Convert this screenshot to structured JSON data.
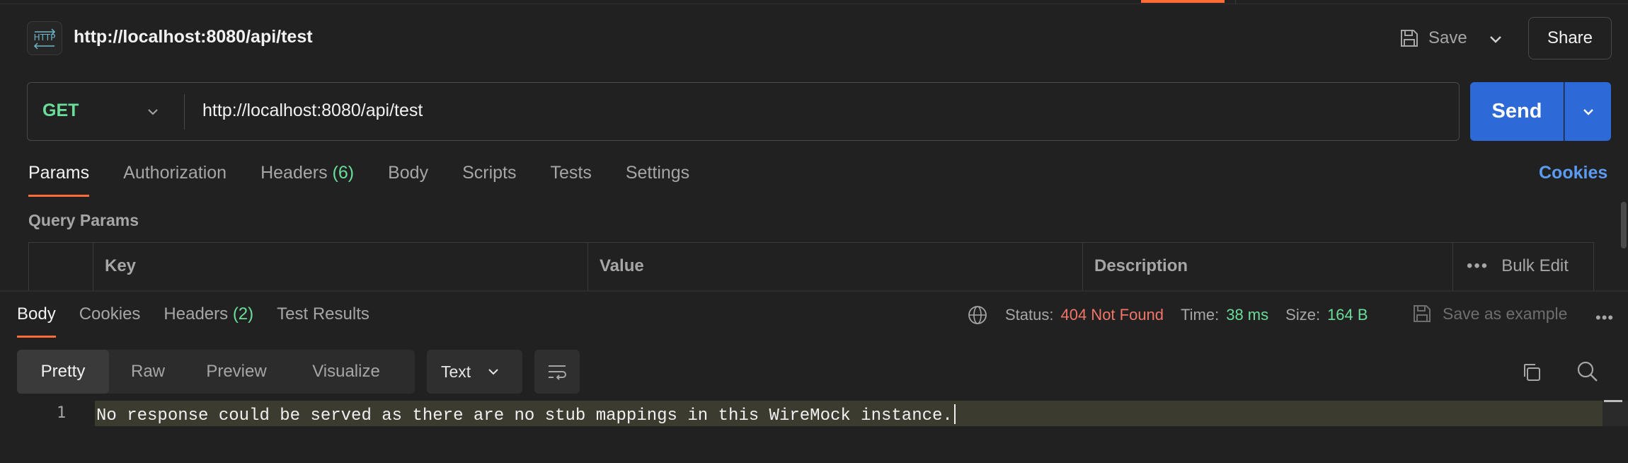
{
  "request": {
    "title": "http://localhost:8080/api/test",
    "http_icon_label": "HTTP",
    "save_label": "Save",
    "share_label": "Share",
    "method": "GET",
    "url": "http://localhost:8080/api/test",
    "send_label": "Send"
  },
  "request_tabs": [
    {
      "label": "Params",
      "active": true
    },
    {
      "label": "Authorization"
    },
    {
      "label": "Headers",
      "count": "(6)"
    },
    {
      "label": "Body"
    },
    {
      "label": "Scripts"
    },
    {
      "label": "Tests"
    },
    {
      "label": "Settings"
    }
  ],
  "cookies_label": "Cookies",
  "query_params": {
    "title": "Query Params",
    "columns": [
      "Key",
      "Value",
      "Description"
    ],
    "bulk_edit_label": "Bulk Edit"
  },
  "response_tabs": [
    {
      "label": "Body",
      "active": true
    },
    {
      "label": "Cookies"
    },
    {
      "label": "Headers",
      "count": "(2)"
    },
    {
      "label": "Test Results"
    }
  ],
  "response_status": {
    "status_label": "Status:",
    "status_value": "404 Not Found",
    "time_label": "Time:",
    "time_value": "38 ms",
    "size_label": "Size:",
    "size_value": "164 B",
    "save_example_label": "Save as example"
  },
  "view_modes": [
    "Pretty",
    "Raw",
    "Preview",
    "Visualize"
  ],
  "active_view": "Pretty",
  "format": "Text",
  "body_lines": [
    {
      "num": "1",
      "text": "No response could be served as there are no stub mappings in this WireMock instance."
    }
  ],
  "colors": {
    "accent_orange": "#ff6c37",
    "send_blue": "#2d6ad8",
    "method_green": "#6bdd9a",
    "status_red": "#f2756a",
    "link_blue": "#5b9bf2"
  }
}
